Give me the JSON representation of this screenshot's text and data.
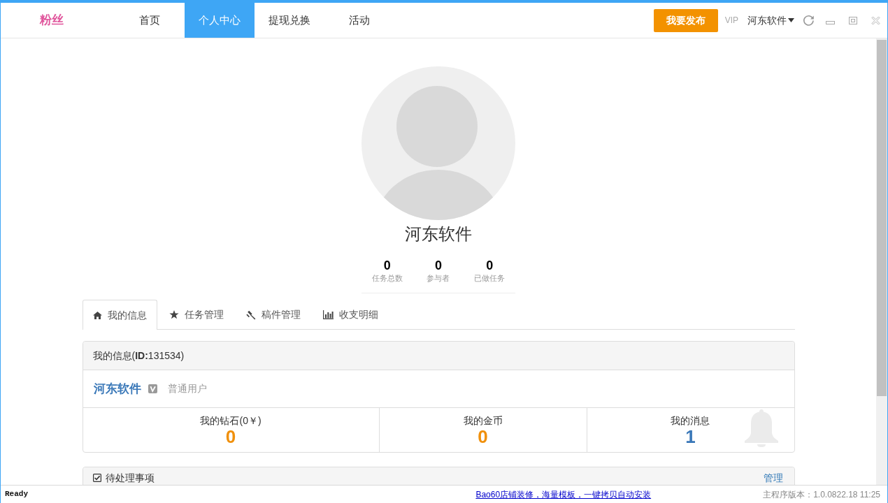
{
  "app": {
    "logo_text": "粉丝"
  },
  "nav": [
    {
      "label": "首页",
      "selected": false
    },
    {
      "label": "个人中心",
      "selected": true
    },
    {
      "label": "提现兑换",
      "selected": false
    },
    {
      "label": "活动",
      "selected": false
    }
  ],
  "toolbar": {
    "publish_button": "我要发布",
    "vip_label": "VIP",
    "user_menu": "河东软件"
  },
  "profile": {
    "name": "河东软件",
    "stats": [
      {
        "value": "0",
        "label": "任务总数"
      },
      {
        "value": "0",
        "label": "参与者"
      },
      {
        "value": "0",
        "label": "已做任务"
      }
    ]
  },
  "tabs": [
    {
      "label": "我的信息",
      "selected": true
    },
    {
      "label": "任务管理",
      "selected": false
    },
    {
      "label": "稿件管理",
      "selected": false
    },
    {
      "label": "收支明细",
      "selected": false
    }
  ],
  "info_panel": {
    "title": "我的信息(**ID:**131534)",
    "user_name": "河东软件",
    "user_level": "普通用户",
    "balances": [
      {
        "kind": "money",
        "label": "我的钻石(0￥)",
        "value": "0"
      },
      {
        "kind": "money",
        "label": "我的金币",
        "value": "0"
      },
      {
        "kind": "message",
        "label": "我的消息",
        "value": "1"
      }
    ]
  },
  "todo_panel": {
    "title": "待处理事项",
    "action": "管理"
  },
  "status_bar": {
    "status": "Ready",
    "ad_link": "Bao60店铺装修，海量模板，一键拷贝自动安装",
    "version": "主程序版本：1.0.0822.18 11:25"
  }
}
